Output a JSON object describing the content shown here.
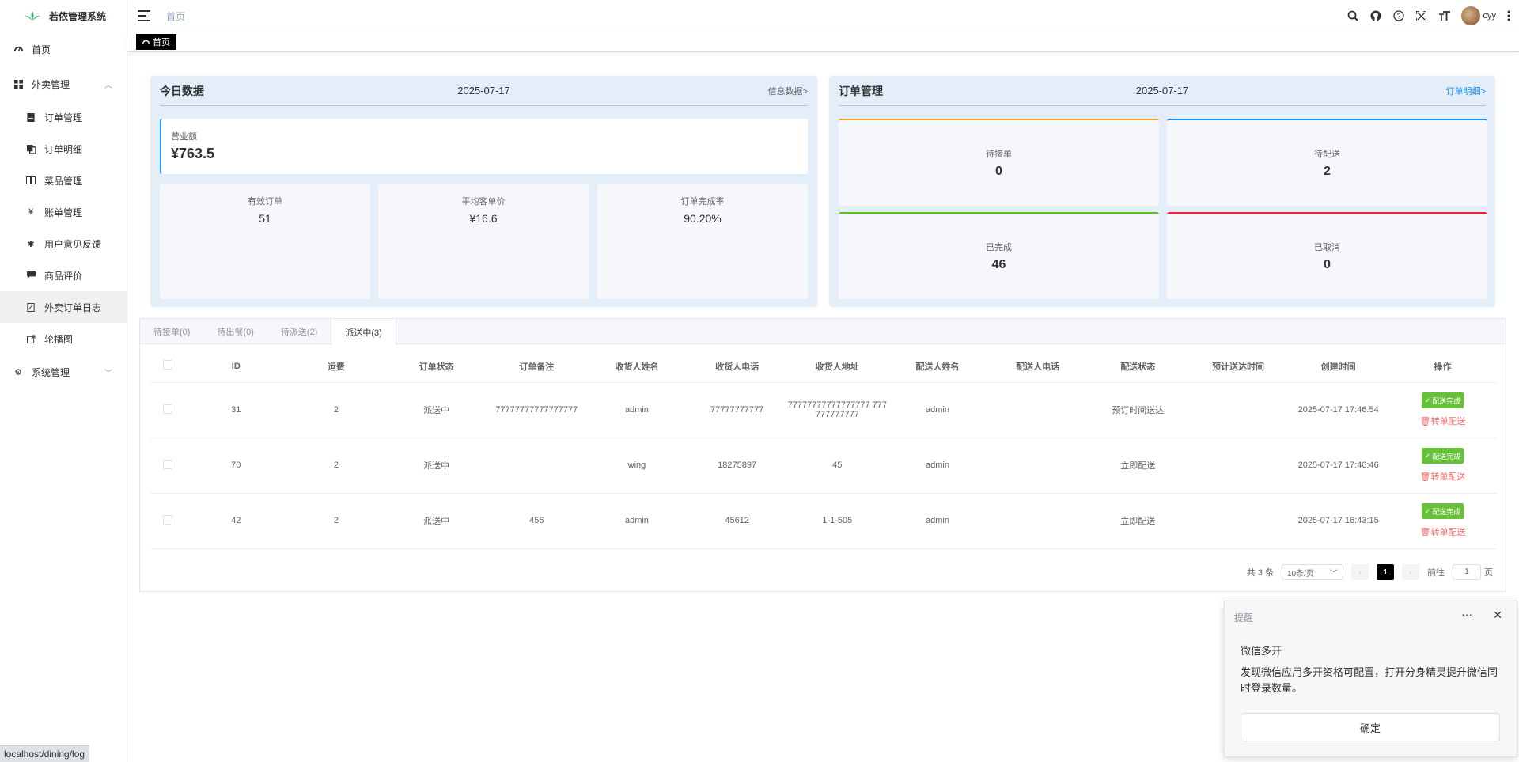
{
  "app": {
    "title": "若依管理系统"
  },
  "sidebar": {
    "items": [
      {
        "label": "首页",
        "icon": "dashboard-icon"
      },
      {
        "label": "外卖管理",
        "icon": "grid-icon",
        "expanded": true
      },
      {
        "label": "订单管理",
        "icon": "document-icon"
      },
      {
        "label": "订单明细",
        "icon": "copy-icon"
      },
      {
        "label": "菜品管理",
        "icon": "book-icon"
      },
      {
        "label": "账单管理",
        "icon": "yen-icon"
      },
      {
        "label": "用户意见反馈",
        "icon": "bug-icon"
      },
      {
        "label": "商品评价",
        "icon": "message-icon"
      },
      {
        "label": "外卖订单日志",
        "icon": "log-icon",
        "active": true
      },
      {
        "label": "轮播图",
        "icon": "link-icon"
      },
      {
        "label": "系统管理",
        "icon": "gear-icon"
      }
    ]
  },
  "header": {
    "breadcrumb": "首页",
    "username": "cyy",
    "icons": [
      "search-icon",
      "github-icon",
      "help-icon",
      "fullscreen-icon",
      "font-size-icon",
      "avatar",
      "more-vertical-icon"
    ]
  },
  "tags": {
    "current": "首页"
  },
  "today": {
    "title": "今日数据",
    "date": "2025-07-17",
    "link": "信息数据>",
    "revenue_label": "营业额",
    "revenue_value": "¥763.5",
    "stats": [
      {
        "label": "有效订单",
        "value": "51"
      },
      {
        "label": "平均客单价",
        "value": "¥16.6"
      },
      {
        "label": "订单完成率",
        "value": "90.20%"
      }
    ]
  },
  "orders": {
    "title": "订单管理",
    "date": "2025-07-17",
    "link": "订单明细>",
    "cards": [
      {
        "label": "待接单",
        "value": "0",
        "color": "#f5a623"
      },
      {
        "label": "待配送",
        "value": "2",
        "color": "#1890ff"
      },
      {
        "label": "已完成",
        "value": "46",
        "color": "#52c41a"
      },
      {
        "label": "已取消",
        "value": "0",
        "color": "#f5222d"
      }
    ]
  },
  "tabs": [
    "待接单(0)",
    "待出餐(0)",
    "待派送(2)",
    "派送中(3)"
  ],
  "table": {
    "headers": [
      "ID",
      "运费",
      "订单状态",
      "订单备注",
      "收货人姓名",
      "收货人电话",
      "收货人地址",
      "配送人姓名",
      "配送人电话",
      "配送状态",
      "预计送达时间",
      "创建时间",
      "操作"
    ],
    "rows": [
      [
        "31",
        "2",
        "派送中",
        "77777777777777777",
        "admin",
        "77777777777",
        "77777777777777777 777777777777",
        "admin",
        "",
        "预订时间送达",
        "",
        "2025-07-17 17:46:54"
      ],
      [
        "70",
        "2",
        "派送中",
        "",
        "wing",
        "18275897",
        "45",
        "admin",
        "",
        "立即配送",
        "",
        "2025-07-17 17:46:46"
      ],
      [
        "42",
        "2",
        "派送中",
        "456",
        "admin",
        "45612",
        "1-1-505",
        "admin",
        "",
        "立即配送",
        "",
        "2025-07-17 16:43:15"
      ]
    ],
    "action_done": "配送完成",
    "action_transfer": "转单配送"
  },
  "pager": {
    "total": "共 3 条",
    "page_size": "10条/页",
    "current": "1",
    "goto_prefix": "前往",
    "goto_value": "1",
    "goto_suffix": "页"
  },
  "notification": {
    "header": "提醒",
    "title": "微信多开",
    "body": "发现微信应用多开资格可配置，打开分身精灵提升微信同时登录数量。",
    "button": "确定"
  },
  "statusbar": "localhost/dining/log"
}
